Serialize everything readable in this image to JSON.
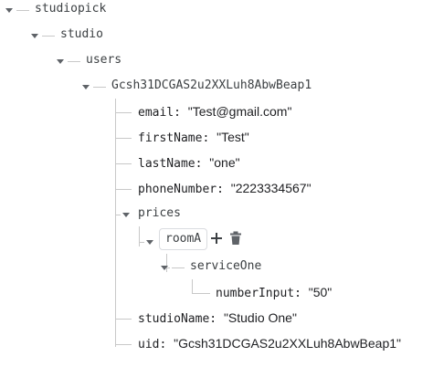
{
  "tree": {
    "root": {
      "key": "studiopick"
    },
    "studio": {
      "key": "studio"
    },
    "users": {
      "key": "users"
    },
    "user": {
      "key": "Gcsh31DCGAS2u2XXLuh8AbwBeap1"
    },
    "fields": {
      "email": {
        "key": "email",
        "value": "\"Test@gmail.com\""
      },
      "firstName": {
        "key": "firstName",
        "value": "\"Test\""
      },
      "lastName": {
        "key": "lastName",
        "value": "\"one\""
      },
      "phoneNumber": {
        "key": "phoneNumber",
        "value": "\"2223334567\""
      }
    },
    "prices": {
      "key": "prices"
    },
    "roomA": {
      "key": "roomA"
    },
    "serviceOne": {
      "key": "serviceOne"
    },
    "numberInput": {
      "key": "numberInput",
      "value": "\"50\""
    },
    "studioName": {
      "key": "studioName",
      "value": "\"Studio One\""
    },
    "uid": {
      "key": "uid",
      "value": "\"Gcsh31DCGAS2u2XXLuh8AbwBeap1\""
    }
  },
  "icons": {
    "add": "plus-icon",
    "delete": "trash-icon",
    "expand": "caret-down-icon"
  },
  "colors": {
    "connector": "#c8c8c8",
    "caret": "#5f6368",
    "delete_icon": "#5f6368",
    "text": "#202124"
  }
}
